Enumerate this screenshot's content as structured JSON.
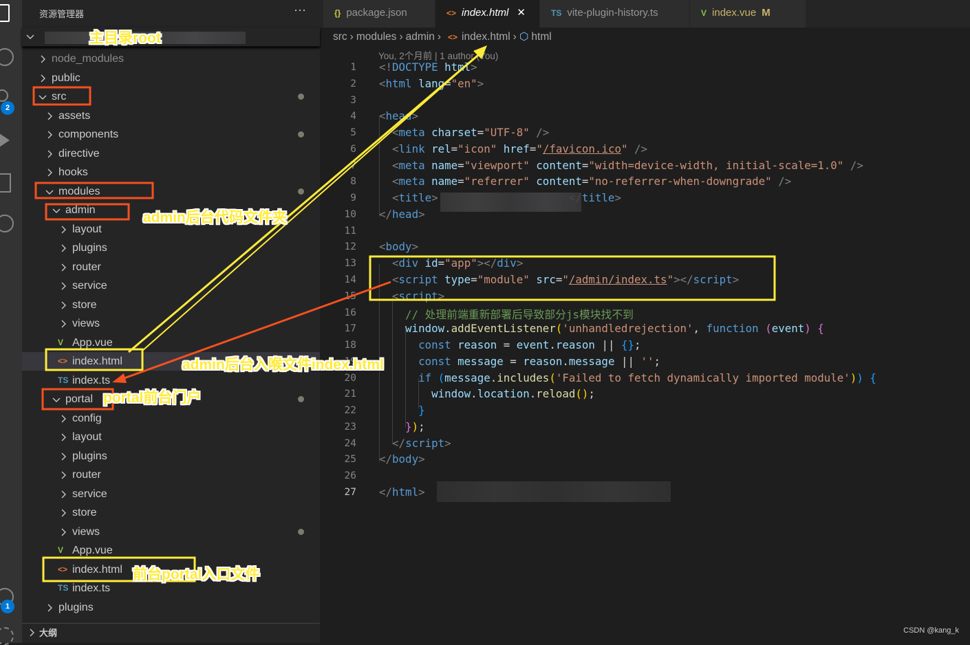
{
  "activity_bar": {
    "scm_badge": "2",
    "accounts_badge": "1"
  },
  "sidebar": {
    "title": "资源管理器",
    "more": "···",
    "outline": "大纲",
    "items": [
      {
        "label": "node_modules",
        "level": 0,
        "kind": "folder",
        "open": false,
        "muted": true
      },
      {
        "label": "public",
        "level": 0,
        "kind": "folder",
        "open": false
      },
      {
        "label": "src",
        "level": 0,
        "kind": "folder",
        "open": true,
        "dot": true
      },
      {
        "label": "assets",
        "level": 1,
        "kind": "folder",
        "open": false
      },
      {
        "label": "components",
        "level": 1,
        "kind": "folder",
        "open": false,
        "dot": true
      },
      {
        "label": "directive",
        "level": 1,
        "kind": "folder",
        "open": false
      },
      {
        "label": "hooks",
        "level": 1,
        "kind": "folder",
        "open": false
      },
      {
        "label": "modules",
        "level": 1,
        "kind": "folder",
        "open": true,
        "dot": true
      },
      {
        "label": "admin",
        "level": 2,
        "kind": "folder",
        "open": true
      },
      {
        "label": "layout",
        "level": 3,
        "kind": "folder",
        "open": false
      },
      {
        "label": "plugins",
        "level": 3,
        "kind": "folder",
        "open": false
      },
      {
        "label": "router",
        "level": 3,
        "kind": "folder",
        "open": false
      },
      {
        "label": "service",
        "level": 3,
        "kind": "folder",
        "open": false
      },
      {
        "label": "store",
        "level": 3,
        "kind": "folder",
        "open": false
      },
      {
        "label": "views",
        "level": 3,
        "kind": "folder",
        "open": false
      },
      {
        "label": "App.vue",
        "level": 3,
        "kind": "vue"
      },
      {
        "label": "index.html",
        "level": 3,
        "kind": "html",
        "selected": true
      },
      {
        "label": "index.ts",
        "level": 3,
        "kind": "ts"
      },
      {
        "label": "portal",
        "level": 2,
        "kind": "folder",
        "open": true,
        "dot": true
      },
      {
        "label": "config",
        "level": 3,
        "kind": "folder",
        "open": false
      },
      {
        "label": "layout",
        "level": 3,
        "kind": "folder",
        "open": false
      },
      {
        "label": "plugins",
        "level": 3,
        "kind": "folder",
        "open": false
      },
      {
        "label": "router",
        "level": 3,
        "kind": "folder",
        "open": false
      },
      {
        "label": "service",
        "level": 3,
        "kind": "folder",
        "open": false
      },
      {
        "label": "store",
        "level": 3,
        "kind": "folder",
        "open": false
      },
      {
        "label": "views",
        "level": 3,
        "kind": "folder",
        "open": false,
        "dot": true
      },
      {
        "label": "App.vue",
        "level": 3,
        "kind": "vue"
      },
      {
        "label": "index.html",
        "level": 3,
        "kind": "html"
      },
      {
        "label": "index.ts",
        "level": 3,
        "kind": "ts"
      },
      {
        "label": "plugins",
        "level": 1,
        "kind": "folder",
        "open": false
      }
    ]
  },
  "icons": {
    "vue": "V",
    "html": "<>",
    "ts": "TS",
    "json": "{}"
  },
  "colors": {
    "vue": "#8dc149",
    "html": "#e37933",
    "ts": "#519aba",
    "json": "#cbcb41",
    "red_box": "#f4511e",
    "yellow_box": "#ffeb3b"
  },
  "tabs": [
    {
      "label": "package.json",
      "kind": "json"
    },
    {
      "label": "index.html",
      "kind": "html",
      "active": true,
      "close": "✕"
    },
    {
      "label": "vite-plugin-history.ts",
      "kind": "ts"
    },
    {
      "label": "index.vue",
      "kind": "vue",
      "modified": "M"
    }
  ],
  "breadcrumb": [
    "src",
    "modules",
    "admin",
    "index.html",
    "html"
  ],
  "blame": "You, 2个月前 | 1 author (You)",
  "code": {
    "current_line": 27,
    "lines": [
      {
        "tokens": [
          [
            "p",
            "<!"
          ],
          [
            "tg",
            "DOCTYPE"
          ],
          [
            "t",
            " "
          ],
          [
            "at",
            "html"
          ],
          [
            "p",
            ">"
          ]
        ]
      },
      {
        "tokens": [
          [
            "p",
            "<"
          ],
          [
            "tg",
            "html"
          ],
          [
            "t",
            " "
          ],
          [
            "at",
            "lang"
          ],
          [
            "t",
            "="
          ],
          [
            "s",
            "\"en\""
          ],
          [
            "p",
            ">"
          ]
        ]
      },
      {
        "tokens": []
      },
      {
        "tokens": [
          [
            "p",
            "<"
          ],
          [
            "tg",
            "head"
          ],
          [
            "p",
            ">"
          ]
        ]
      },
      {
        "tokens": [
          [
            "t",
            "  "
          ],
          [
            "p",
            "<"
          ],
          [
            "tg",
            "meta"
          ],
          [
            "t",
            " "
          ],
          [
            "at",
            "charset"
          ],
          [
            "t",
            "="
          ],
          [
            "s",
            "\"UTF-8\""
          ],
          [
            "t",
            " "
          ],
          [
            "p",
            "/>"
          ]
        ]
      },
      {
        "tokens": [
          [
            "t",
            "  "
          ],
          [
            "p",
            "<"
          ],
          [
            "tg",
            "link"
          ],
          [
            "t",
            " "
          ],
          [
            "at",
            "rel"
          ],
          [
            "t",
            "="
          ],
          [
            "s",
            "\"icon\""
          ],
          [
            "t",
            " "
          ],
          [
            "at",
            "href"
          ],
          [
            "t",
            "="
          ],
          [
            "s",
            "\""
          ],
          [
            "su",
            "/favicon.ico"
          ],
          [
            "s",
            "\""
          ],
          [
            "t",
            " "
          ],
          [
            "p",
            "/>"
          ]
        ]
      },
      {
        "tokens": [
          [
            "t",
            "  "
          ],
          [
            "p",
            "<"
          ],
          [
            "tg",
            "meta"
          ],
          [
            "t",
            " "
          ],
          [
            "at",
            "name"
          ],
          [
            "t",
            "="
          ],
          [
            "s",
            "\"viewport\""
          ],
          [
            "t",
            " "
          ],
          [
            "at",
            "content"
          ],
          [
            "t",
            "="
          ],
          [
            "s",
            "\"width=device-width, initial-scale=1.0\""
          ],
          [
            "t",
            " "
          ],
          [
            "p",
            "/>"
          ]
        ]
      },
      {
        "tokens": [
          [
            "t",
            "  "
          ],
          [
            "p",
            "<"
          ],
          [
            "tg",
            "meta"
          ],
          [
            "t",
            " "
          ],
          [
            "at",
            "name"
          ],
          [
            "t",
            "="
          ],
          [
            "s",
            "\"referrer\""
          ],
          [
            "t",
            " "
          ],
          [
            "at",
            "content"
          ],
          [
            "t",
            "="
          ],
          [
            "s",
            "\"no-referrer-when-downgrade\""
          ],
          [
            "t",
            " "
          ],
          [
            "p",
            "/>"
          ]
        ]
      },
      {
        "tokens": [
          [
            "t",
            "  "
          ],
          [
            "p",
            "<"
          ],
          [
            "tg",
            "title"
          ],
          [
            "p",
            ">"
          ],
          [
            "t",
            "                    "
          ],
          [
            "p",
            "</"
          ],
          [
            "tg",
            "title"
          ],
          [
            "p",
            ">"
          ]
        ]
      },
      {
        "tokens": [
          [
            "p",
            "</"
          ],
          [
            "tg",
            "head"
          ],
          [
            "p",
            ">"
          ]
        ]
      },
      {
        "tokens": []
      },
      {
        "tokens": [
          [
            "p",
            "<"
          ],
          [
            "tg",
            "body"
          ],
          [
            "p",
            ">"
          ]
        ]
      },
      {
        "tokens": [
          [
            "t",
            "  "
          ],
          [
            "p",
            "<"
          ],
          [
            "tg",
            "div"
          ],
          [
            "t",
            " "
          ],
          [
            "at",
            "id"
          ],
          [
            "t",
            "="
          ],
          [
            "s",
            "\"app\""
          ],
          [
            "p",
            "></"
          ],
          [
            "tg",
            "div"
          ],
          [
            "p",
            ">"
          ]
        ]
      },
      {
        "tokens": [
          [
            "t",
            "  "
          ],
          [
            "p",
            "<"
          ],
          [
            "tg",
            "script"
          ],
          [
            "t",
            " "
          ],
          [
            "at",
            "type"
          ],
          [
            "t",
            "="
          ],
          [
            "s",
            "\"module\""
          ],
          [
            "t",
            " "
          ],
          [
            "at",
            "src"
          ],
          [
            "t",
            "="
          ],
          [
            "s",
            "\""
          ],
          [
            "su",
            "/admin/index.ts"
          ],
          [
            "s",
            "\""
          ],
          [
            "p",
            "></"
          ],
          [
            "tg",
            "script"
          ],
          [
            "p",
            ">"
          ]
        ]
      },
      {
        "tokens": [
          [
            "t",
            "  "
          ],
          [
            "p",
            "<"
          ],
          [
            "tg",
            "script"
          ],
          [
            "p",
            ">"
          ]
        ]
      },
      {
        "tokens": [
          [
            "t",
            "    "
          ],
          [
            "cm",
            "// 处理前端重新部署后导致部分js模块找不到"
          ]
        ]
      },
      {
        "tokens": [
          [
            "t",
            "    "
          ],
          [
            "v",
            "window"
          ],
          [
            "t",
            "."
          ],
          [
            "fn",
            "addEventListener"
          ],
          [
            "b1",
            "("
          ],
          [
            "s",
            "'unhandledrejection'"
          ],
          [
            "t",
            ", "
          ],
          [
            "kw",
            "function"
          ],
          [
            "t",
            " "
          ],
          [
            "b2",
            "("
          ],
          [
            "v",
            "event"
          ],
          [
            "b2",
            ")"
          ],
          [
            "t",
            " "
          ],
          [
            "b2",
            "{"
          ]
        ]
      },
      {
        "tokens": [
          [
            "t",
            "      "
          ],
          [
            "kw",
            "const"
          ],
          [
            "t",
            " "
          ],
          [
            "v",
            "reason"
          ],
          [
            "t",
            " = "
          ],
          [
            "v",
            "event"
          ],
          [
            "t",
            "."
          ],
          [
            "v",
            "reason"
          ],
          [
            "t",
            " || "
          ],
          [
            "b3",
            "{}"
          ],
          [
            "t",
            ";"
          ]
        ]
      },
      {
        "tokens": [
          [
            "t",
            "      "
          ],
          [
            "kw",
            "const"
          ],
          [
            "t",
            " "
          ],
          [
            "v",
            "message"
          ],
          [
            "t",
            " = "
          ],
          [
            "v",
            "reason"
          ],
          [
            "t",
            "."
          ],
          [
            "v",
            "message"
          ],
          [
            "t",
            " || "
          ],
          [
            "s",
            "''"
          ],
          [
            "t",
            ";"
          ]
        ]
      },
      {
        "tokens": [
          [
            "t",
            "      "
          ],
          [
            "kw",
            "if"
          ],
          [
            "t",
            " "
          ],
          [
            "b3",
            "("
          ],
          [
            "v",
            "message"
          ],
          [
            "t",
            "."
          ],
          [
            "fn",
            "includes"
          ],
          [
            "b1",
            "("
          ],
          [
            "s",
            "'Failed to fetch dynamically imported module'"
          ],
          [
            "b1",
            ")"
          ],
          [
            "b3",
            ")"
          ],
          [
            "t",
            " "
          ],
          [
            "b3",
            "{"
          ]
        ]
      },
      {
        "tokens": [
          [
            "t",
            "        "
          ],
          [
            "v",
            "window"
          ],
          [
            "t",
            "."
          ],
          [
            "v",
            "location"
          ],
          [
            "t",
            "."
          ],
          [
            "fn",
            "reload"
          ],
          [
            "b1",
            "()"
          ],
          [
            "t",
            ";"
          ]
        ]
      },
      {
        "tokens": [
          [
            "t",
            "      "
          ],
          [
            "b3",
            "}"
          ]
        ]
      },
      {
        "tokens": [
          [
            "t",
            "    "
          ],
          [
            "b2",
            "}"
          ],
          [
            "b1",
            ")"
          ],
          [
            "t",
            ";"
          ]
        ]
      },
      {
        "tokens": [
          [
            "t",
            "  "
          ],
          [
            "p",
            "</"
          ],
          [
            "tg",
            "script"
          ],
          [
            "p",
            ">"
          ]
        ]
      },
      {
        "tokens": [
          [
            "p",
            "</"
          ],
          [
            "tg",
            "body"
          ],
          [
            "p",
            ">"
          ]
        ]
      },
      {
        "tokens": []
      },
      {
        "tokens": [
          [
            "p",
            "</"
          ],
          [
            "tg",
            "html"
          ],
          [
            "p",
            ">"
          ]
        ]
      }
    ]
  },
  "annotations": {
    "root": "主目录root",
    "admin_folder": "admin后台代码文件夹",
    "admin_entry": "admin后台入喉文件index.html",
    "portal": "portal前台门户",
    "portal_entry": "前台portal入口文件"
  },
  "watermark": "CSDN @kang_k"
}
